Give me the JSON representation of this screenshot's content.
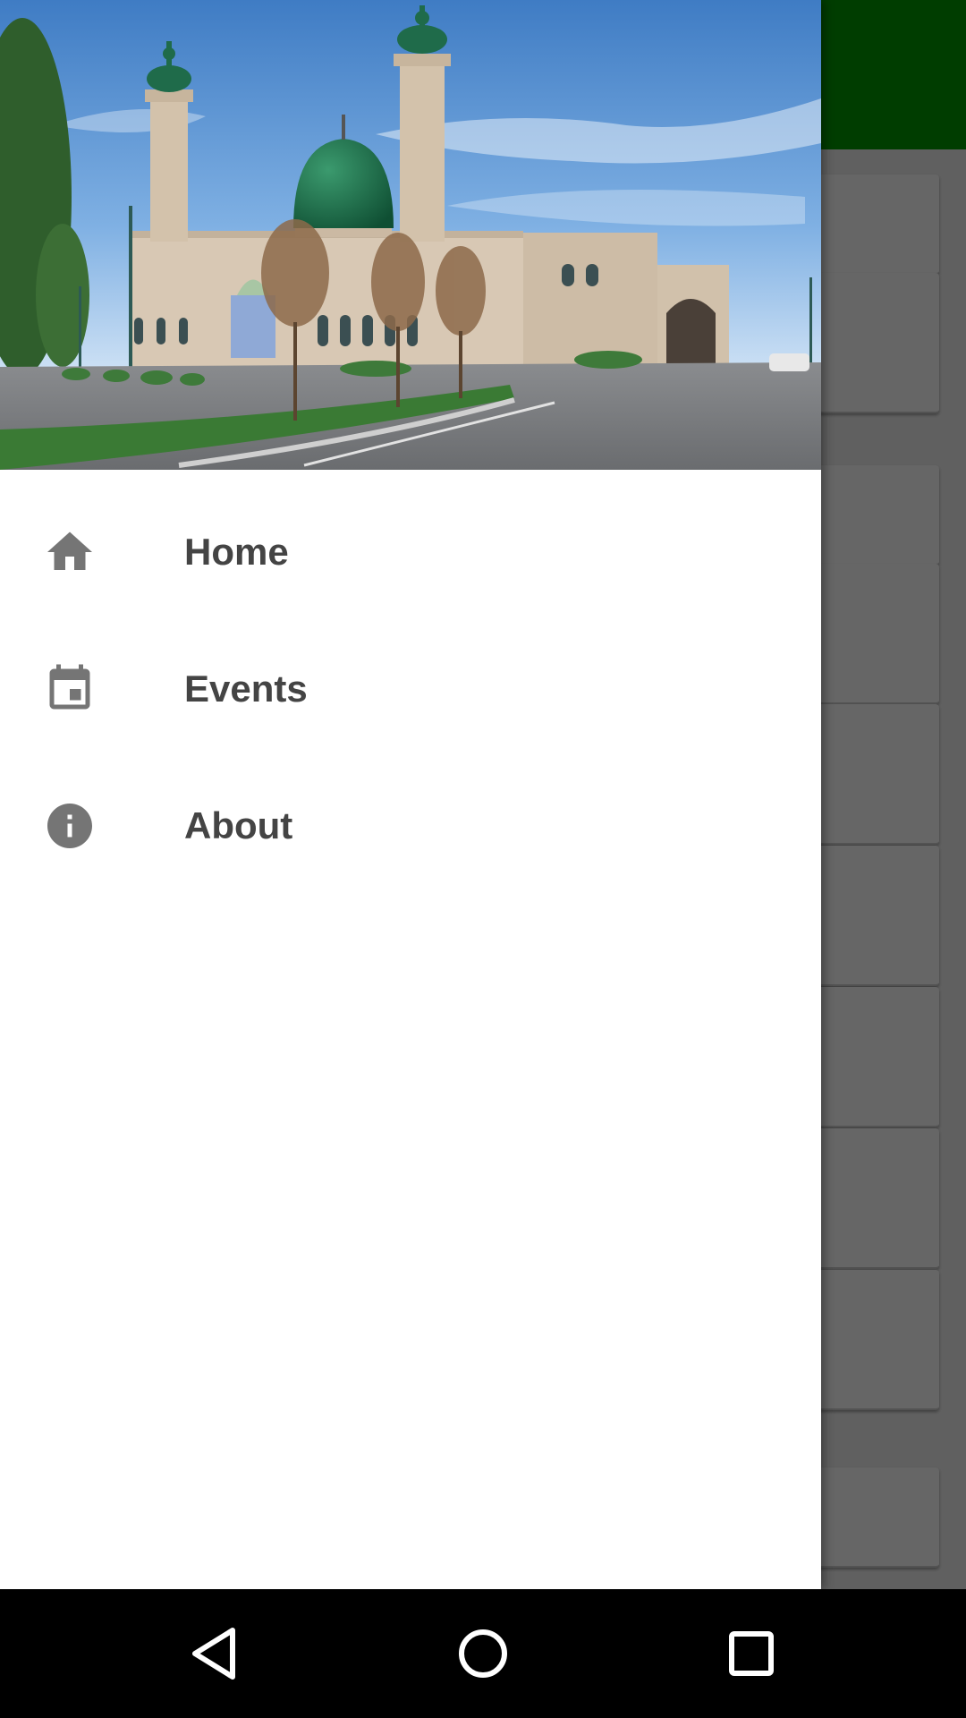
{
  "app": {
    "toolbar_color": "#009900"
  },
  "drawer": {
    "header_image": "mosque-photo",
    "items": [
      {
        "label": "Home",
        "icon": "home-icon"
      },
      {
        "label": "Events",
        "icon": "calendar-icon"
      },
      {
        "label": "About",
        "icon": "info-icon"
      }
    ]
  },
  "colors": {
    "menu_text": "#444444",
    "menu_icon": "#757575",
    "mosque_dome": "#1f6b4a",
    "sky": "#4a86c9"
  },
  "navbar": {
    "buttons": [
      "back-button",
      "home-button",
      "recents-button"
    ]
  }
}
